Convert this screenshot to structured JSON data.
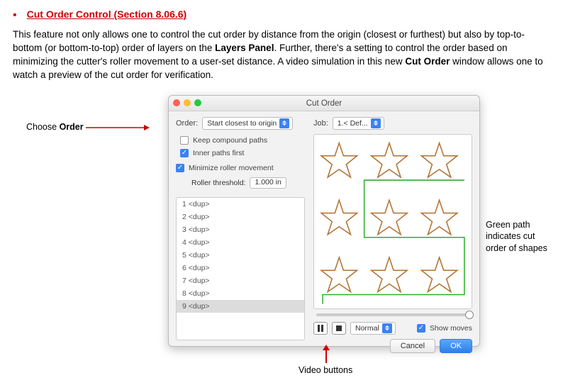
{
  "heading": "Cut Order Control (Section 8.06.6)",
  "paragraph": {
    "p1": "This feature not only allows one to control the cut order by distance from the origin (closest or furthest) but also by top-to-bottom (or bottom-to-top) order of layers on the ",
    "b1": "Layers Panel",
    "p2": ". Further, there's a setting to control the order based on minimizing the cutter's roller movement to a user-set distance. A video simulation in this new ",
    "b2": "Cut Order",
    "p3": " window allows one to watch a preview of the cut order for verification."
  },
  "callouts": {
    "choose_order_pre": "Choose ",
    "choose_order_b": "Order",
    "green_path": "Green path indicates cut order of shapes",
    "video_buttons": "Video buttons"
  },
  "dialog": {
    "title": "Cut Order",
    "order_label": "Order:",
    "order_value": "Start closest to origin",
    "job_label": "Job:",
    "job_value": "1.< Def...",
    "keep_label": "Keep compound paths",
    "inner_label": "Inner paths first",
    "minroll_label": "Minimize roller movement",
    "thresh_label": "Roller threshold:",
    "thresh_value": "1.000 in",
    "list": [
      "1  <dup>",
      "2  <dup>",
      "3  <dup>",
      "4  <dup>",
      "5  <dup>",
      "6  <dup>",
      "7  <dup>",
      "8  <dup>",
      "9  <dup>"
    ],
    "speed_value": "Normal",
    "show_moves": "Show moves",
    "cancel": "Cancel",
    "ok": "OK"
  }
}
